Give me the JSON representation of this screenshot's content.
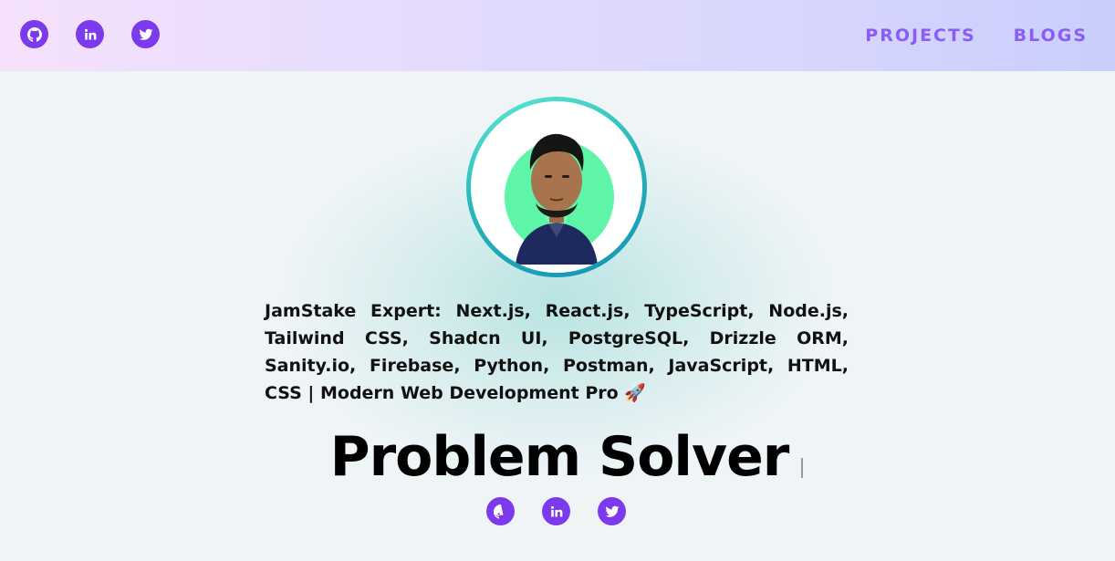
{
  "header": {
    "social": [
      {
        "icon": "github-icon"
      },
      {
        "icon": "linkedin-icon"
      },
      {
        "icon": "twitter-icon"
      }
    ],
    "nav": {
      "projects": "PROJECTS",
      "blogs": "BLOGS"
    }
  },
  "hero": {
    "description": "JamStake Expert: Next.js, React.js, TypeScript, Node.js, Tailwind CSS, Shadcn UI, PostgreSQL, Drizzle ORM, Sanity.io, Firebase, Python, Postman, JavaScript, HTML, CSS | Modern Web Development Pro",
    "description_emoji": "🚀",
    "typed_title": "Problem Solver",
    "social": [
      {
        "icon": "github-icon"
      },
      {
        "icon": "linkedin-icon"
      },
      {
        "icon": "twitter-icon"
      }
    ]
  },
  "colors": {
    "accent": "#7c3aed",
    "nav_text": "#8b5cf6",
    "avatar_bg": "#5ef5a8",
    "ring_start": "#5eead4",
    "ring_end": "#1193b8"
  }
}
